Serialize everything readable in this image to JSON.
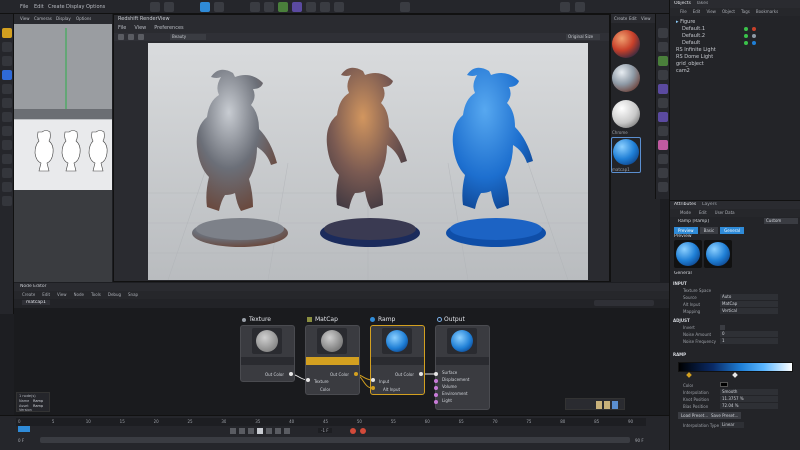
{
  "menubar": {
    "items": [
      "File",
      "Edit",
      "Create",
      "Display",
      "Options"
    ]
  },
  "viewport": {
    "menus": [
      "View",
      "Cameras",
      "Display",
      "Options"
    ]
  },
  "render_view": {
    "title": "Redshift RenderView",
    "menus": [
      "File",
      "View",
      "Preferences"
    ],
    "toolbar_left": "Beauty",
    "toolbar_right": "Original Size"
  },
  "material_manager": {
    "menus": [
      "Create",
      "Edit",
      "View"
    ],
    "materials": [
      {
        "label": "",
        "color": "#c8402a"
      },
      {
        "label": "",
        "color": "#8e9aa6"
      },
      {
        "label": "Chrome",
        "color": "#dcdcdc"
      },
      {
        "label": "matcap1",
        "color": "#1f7fd6"
      }
    ]
  },
  "object_manager": {
    "tabs": [
      "Objects",
      "Takes"
    ],
    "menus": [
      "File",
      "Edit",
      "View",
      "Object",
      "Tags",
      "Bookmarks"
    ],
    "rows": [
      "Figure",
      "Default.1",
      "Default.2",
      "Default",
      "RS Infinite Light",
      "RS Dome Light",
      "grid_object",
      "cam2"
    ]
  },
  "attributes": {
    "tabs": [
      "Attributes",
      "Layers"
    ],
    "menus": [
      "Mode",
      "Edit",
      "User Data"
    ],
    "node_title": "Ramp [Ramp]",
    "dropdown": "Custom",
    "sub_tabs": [
      "Preview",
      "Basic",
      "General"
    ],
    "preview_label": "Preview",
    "section_general": "General",
    "section_input": "INPUT",
    "rows_input": [
      {
        "label": "Texture Space",
        "value": ""
      },
      {
        "label": "Source",
        "value": "Auto"
      },
      {
        "label": "Alt Input",
        "value": "MatCap"
      },
      {
        "label": "Mapping",
        "value": "Vertical"
      }
    ],
    "section_adjust": "ADJUST",
    "rows_adjust": [
      {
        "label": "Invert",
        "value": ""
      },
      {
        "label": "Noise Amount",
        "value": "0"
      },
      {
        "label": "Noise Frequency",
        "value": "1"
      }
    ],
    "section_ramp": "RAMP",
    "rows_ramp": [
      {
        "label": "Color",
        "value": ""
      },
      {
        "label": "Interpolation",
        "value": "Smooth"
      },
      {
        "label": "Knot Position",
        "value": "11.3757 %"
      },
      {
        "label": "Bias Position",
        "value": "72.04 %"
      }
    ],
    "ramp_buttons": [
      "Load Preset...",
      "Save Preset..."
    ],
    "interp_type_label": "Interpolation Type",
    "interp_type_value": "Linear"
  },
  "node_editor": {
    "title": "Node Editor",
    "menus": [
      "Create",
      "Edit",
      "View",
      "Node",
      "Tools",
      "Debug",
      "Snap"
    ],
    "tab": "matcap1",
    "info": {
      "line1": "1 node(s)",
      "line2": "Name",
      "line2v": "Ramp",
      "line3": "Asset",
      "line3v": "Ramp",
      "line4": "Version"
    },
    "nodes": [
      {
        "title": "Texture",
        "out_label": "Out Color"
      },
      {
        "title": "MatCap",
        "in_label": "Texture",
        "in2_label": "Color",
        "out_label": "Out Color"
      },
      {
        "title": "Ramp",
        "in_label": "Input",
        "in2_label": "Alt Input",
        "out_label": "Out Color"
      },
      {
        "title": "Output",
        "in_labels": [
          "Surface",
          "Displacement",
          "Volume",
          "Environment",
          "Light"
        ]
      }
    ]
  },
  "timeline": {
    "ticks": [
      "0",
      "5",
      "10",
      "15",
      "20",
      "25",
      "30",
      "35",
      "40",
      "45",
      "50",
      "55",
      "60",
      "65",
      "70",
      "75",
      "80",
      "85",
      "90"
    ],
    "start": "0 F",
    "end": "90 F",
    "current": "-1 F"
  },
  "colors": {
    "accent": "#2f8bd8",
    "ramp_yellow": "#d3a020"
  }
}
